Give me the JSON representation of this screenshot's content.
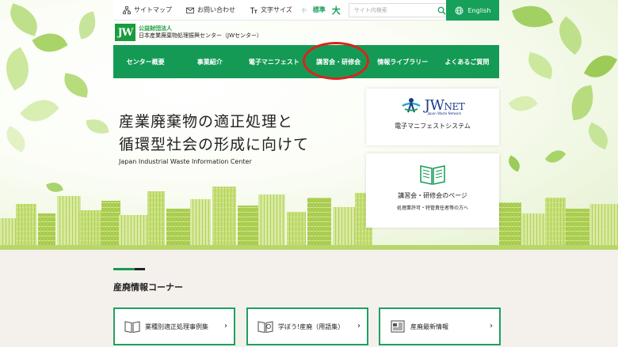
{
  "top_bar": {
    "sitemap_label": "サイトマップ",
    "contact_label": "お問い合わせ",
    "font_size_label": "文字サイズ",
    "font_size_options": [
      "小",
      "標準",
      "大"
    ],
    "search_placeholder": "サイト内検索",
    "language_label": "English"
  },
  "logo": {
    "mark": "JW",
    "subtitle": "公益財団法人",
    "name": "日本産業廃棄物処理振興センター（JWセンター）"
  },
  "nav": {
    "items": [
      {
        "label": "センター概要"
      },
      {
        "label": "事業紹介"
      },
      {
        "label": "電子マニフェスト"
      },
      {
        "label": "講習会・研修会"
      },
      {
        "label": "情報ライブラリー"
      },
      {
        "label": "よくあるご質問"
      }
    ]
  },
  "hero": {
    "title_line1": "産業廃棄物の適正処理と",
    "title_line2": "循環型社会の形成に向けて",
    "subtitle_en": "Japan Industrial Waste Information Center"
  },
  "cards": {
    "jwnet": {
      "logo_text": "JW",
      "logo_text2": "NET",
      "logo_sub": "Japan Waste Network",
      "label": "電子マニフェストシステム"
    },
    "seminar": {
      "label": "講習会・研修会のページ",
      "sublabel": "処理業許可・特管責任者等の方へ"
    }
  },
  "info_section": {
    "title": "産廃情報コーナー",
    "tiles": [
      {
        "label": "業種別適正処理事例集"
      },
      {
        "label": "学ぼう!産廃（用語集）"
      },
      {
        "label": "産廃最新情報"
      }
    ]
  },
  "colors": {
    "brand_green": "#159a55",
    "highlight_red": "#d9241c",
    "jwnet_blue": "#1c3a88"
  }
}
